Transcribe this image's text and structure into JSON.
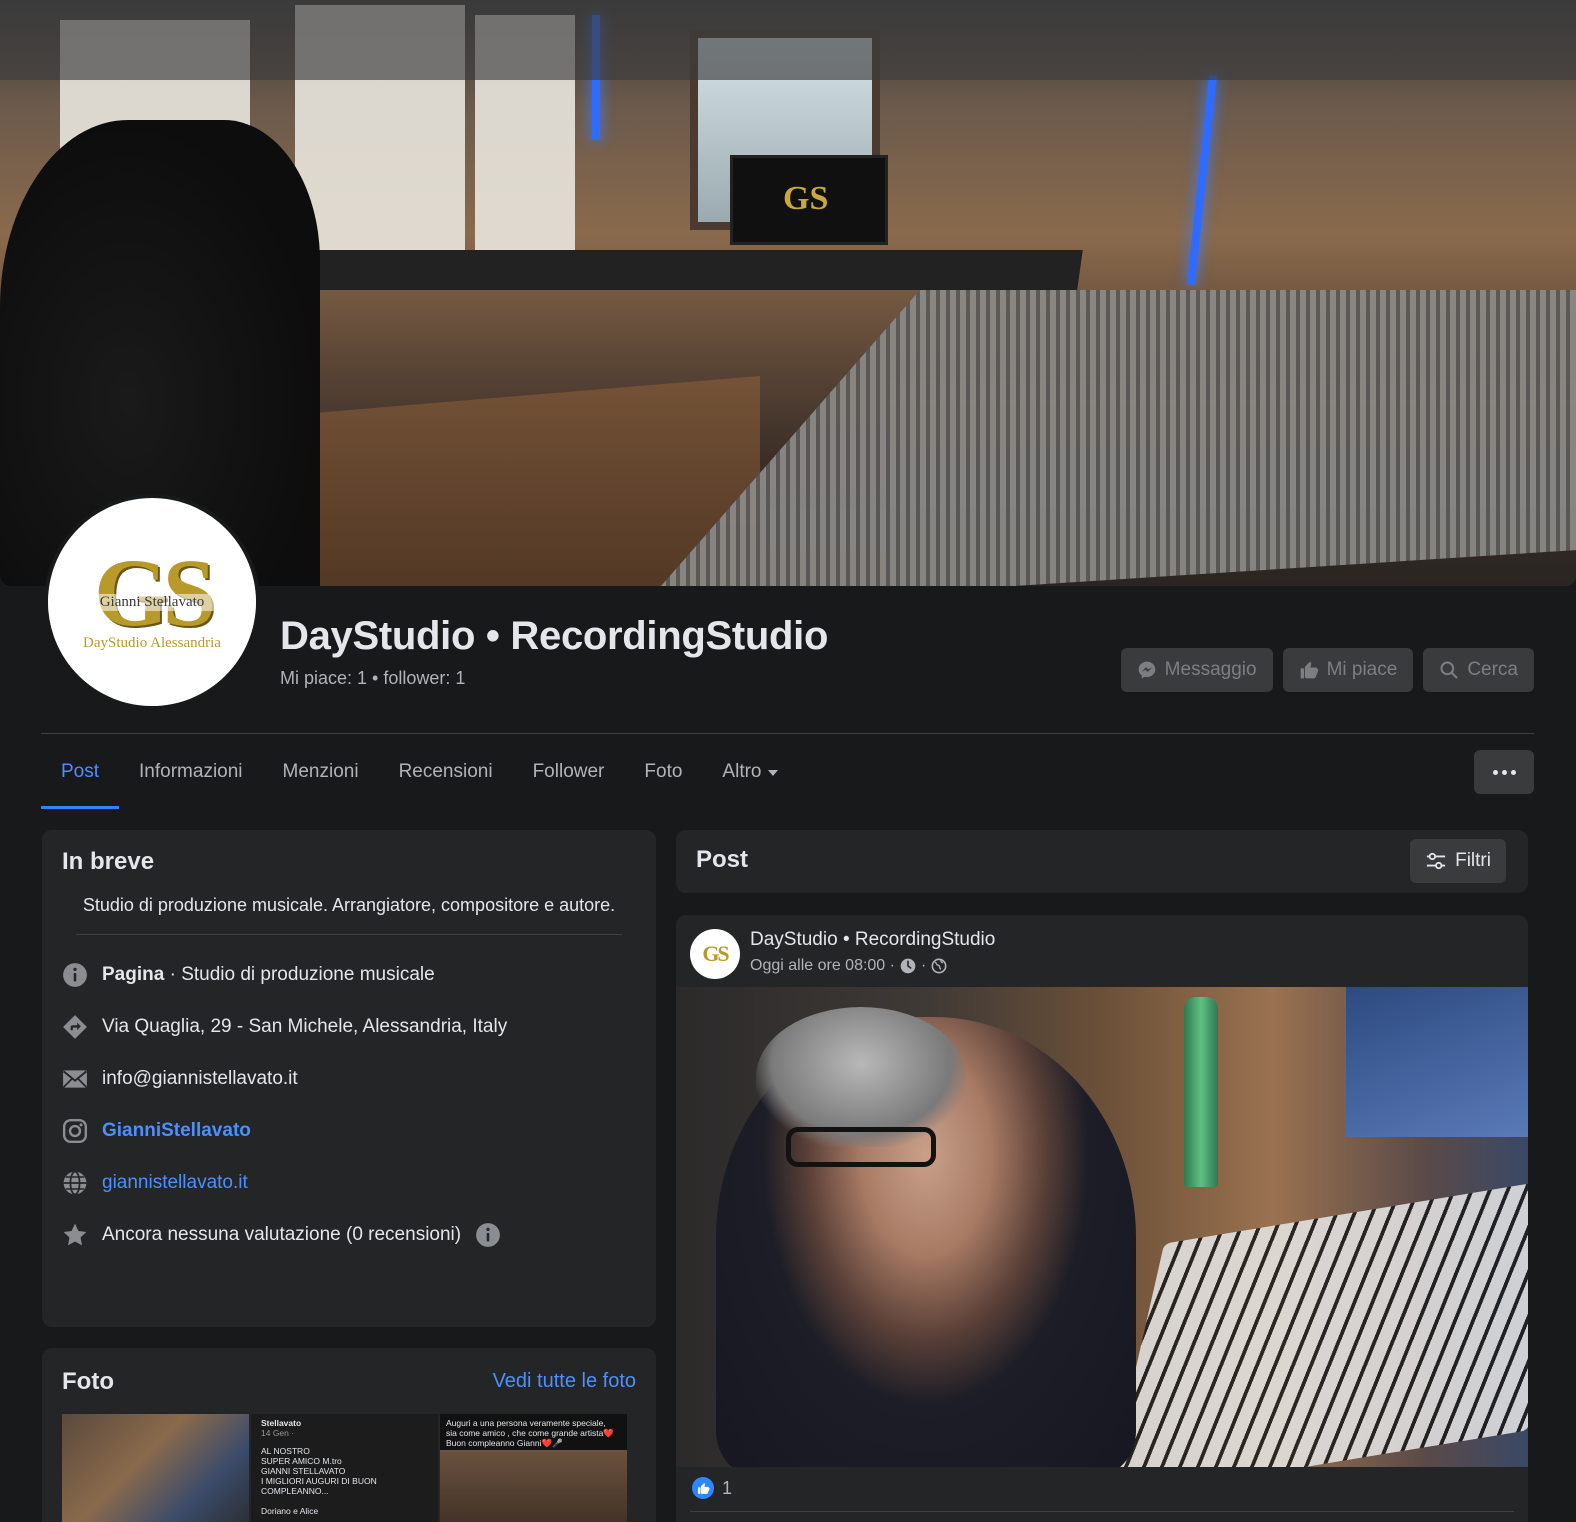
{
  "page": {
    "title": "DayStudio • RecordingStudio",
    "stats": "Mi piace: 1 • follower: 1",
    "avatar": {
      "monogram": "GS",
      "name": "Gianni Stellavato",
      "subtitle": "DayStudio Alessandria"
    },
    "cover_monitor_text": "GS"
  },
  "actions": {
    "message": "Messaggio",
    "like": "Mi piace",
    "search": "Cerca"
  },
  "tabs": [
    {
      "label": "Post",
      "active": true
    },
    {
      "label": "Informazioni"
    },
    {
      "label": "Menzioni"
    },
    {
      "label": "Recensioni"
    },
    {
      "label": "Follower"
    },
    {
      "label": "Foto"
    },
    {
      "label": "Altro"
    }
  ],
  "intro": {
    "title": "In breve",
    "description": "Studio di produzione musicale. Arrangiatore, compositore e autore.",
    "page_label": "Pagina",
    "category": " · Studio di produzione musicale",
    "address": "Via Quaglia, 29 - San Michele, Alessandria, Italy",
    "email": "info@giannistellavato.it",
    "instagram": "GianniStellavato",
    "website": "giannistellavato.it",
    "rating": "Ancora nessuna valutazione (0 recensioni)"
  },
  "photos": {
    "title": "Foto",
    "see_all": "Vedi tutte le foto",
    "thumb2_lines": [
      "Stellavato",
      "14 Gen · ",
      "AL NOSTRO",
      "SUPER AMICO M.tro",
      "GIANNI STELLAVATO",
      "I MIGLIORI AUGURI DI BUON",
      "COMPLEANNO...",
      "",
      "Doriano e Alice"
    ],
    "thumb3_lines": [
      "Auguri a una persona veramente speciale,",
      "sia come amico , che come grande artista❤️",
      "Buon compleanno Gianni❤️🎤"
    ]
  },
  "posts_section": {
    "title": "Post",
    "filters": "Filtri"
  },
  "post": {
    "author": "DayStudio • RecordingStudio",
    "avatar_monogram": "GS",
    "time": "Oggi alle ore 08:00 ·",
    "meta_sep": "·",
    "like_count": "1"
  },
  "colors": {
    "background": "#18191a",
    "card": "#242526",
    "accent": "#2d88ff",
    "link": "#4a90ff",
    "button": "#3a3b3c"
  }
}
